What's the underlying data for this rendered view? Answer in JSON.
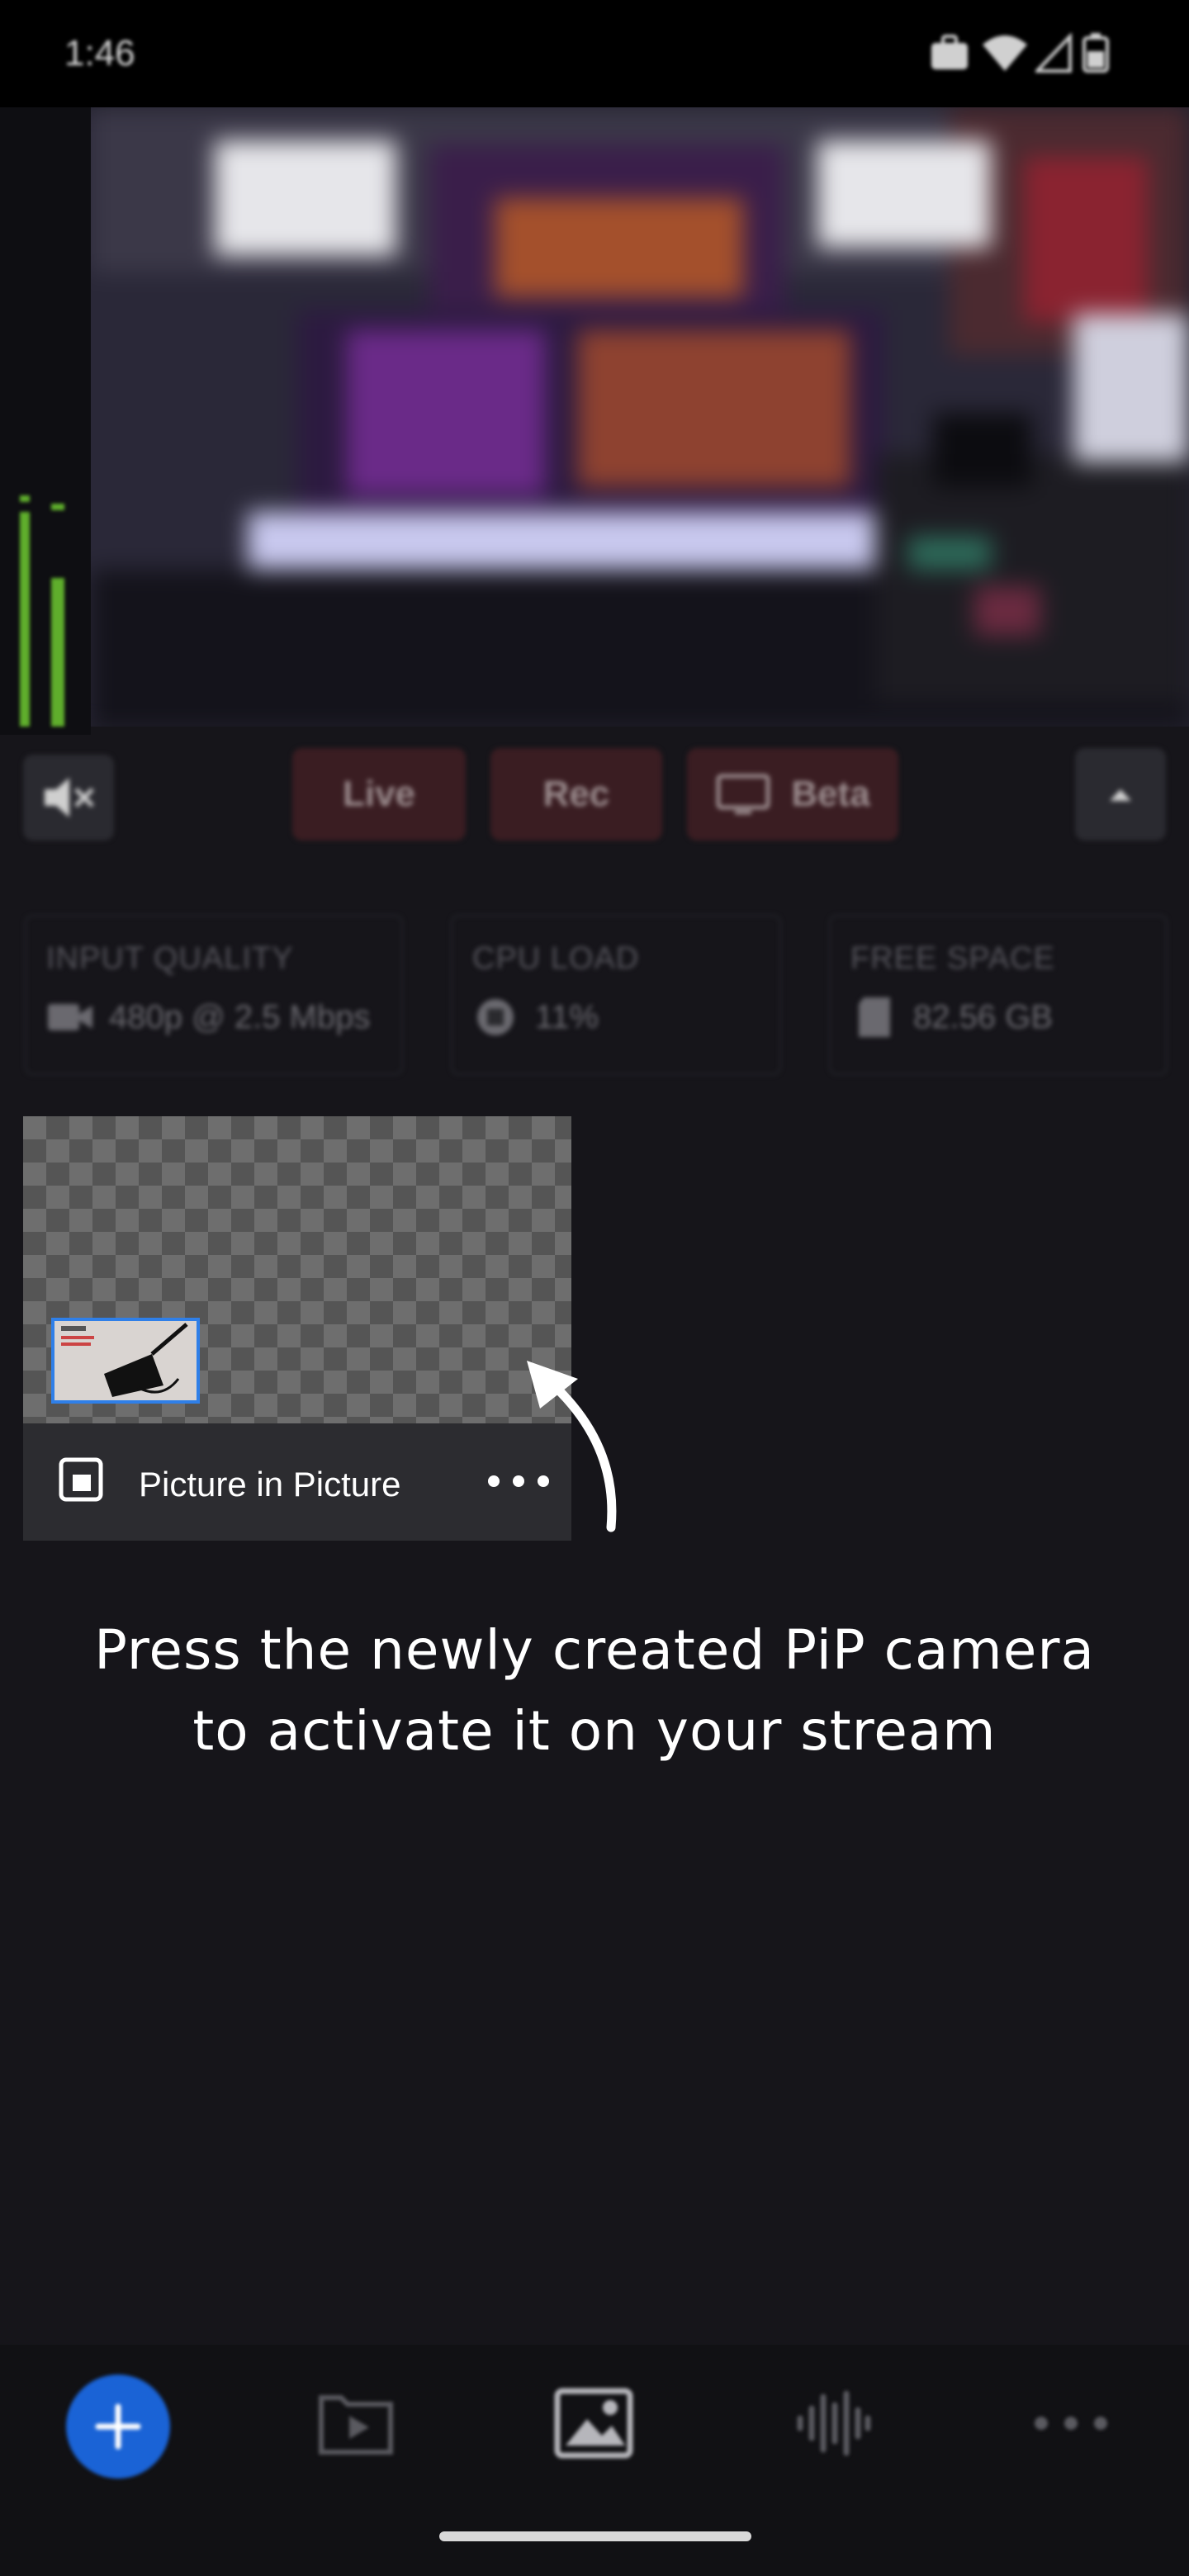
{
  "status_bar": {
    "time": "1:46"
  },
  "controls": {
    "live_label": "Live",
    "rec_label": "Rec",
    "beta_label": "Beta"
  },
  "stats": [
    {
      "title": "INPUT QUALITY",
      "value": "480p @ 2.5 Mbps",
      "icon": "video-camera-icon"
    },
    {
      "title": "CPU LOAD",
      "value": "11%",
      "icon": "cpu-icon"
    },
    {
      "title": "FREE SPACE",
      "value": "82.56 GB",
      "icon": "sd-card-icon"
    }
  ],
  "pip_card": {
    "label": "Picture in Picture",
    "icon": "picture-in-picture-icon"
  },
  "instruction": {
    "line1": "Press the newly created PiP camera",
    "line2": "to activate it on your stream"
  },
  "bottom_nav": [
    "add-icon",
    "media-player-icon",
    "image-icon",
    "audio-waveform-icon",
    "more-icon"
  ],
  "colors": {
    "accent": "#1a63d6",
    "pip_border": "#2f7fe8",
    "live_button_bg": "#3a1d22",
    "background": "#16151a"
  }
}
